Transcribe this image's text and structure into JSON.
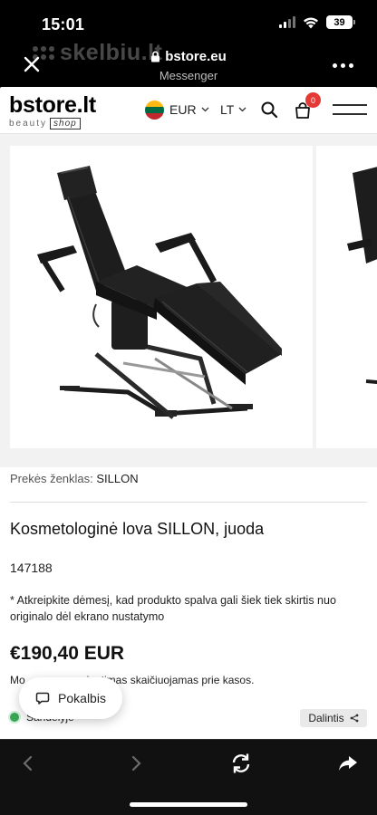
{
  "status_bar": {
    "time": "15:01",
    "battery": "39"
  },
  "browser": {
    "url": "bstore.eu",
    "subtitle": "Messenger",
    "watermark": "skelbiu.lt"
  },
  "site": {
    "logo_main": "bstore.lt",
    "logo_sub_a": "beauty",
    "logo_sub_b": "shop",
    "currency": "EUR",
    "language": "LT",
    "cart_count": "0"
  },
  "product": {
    "brand_label": "Prekės ženklas:",
    "brand_value": "SILLON",
    "title": "Kosmetologinė lova SILLON, juoda",
    "sku": "147188",
    "note": "* Atkreipkite dėmesį, kad produkto spalva gali šiek tiek skirtis nuo originalo dėl ekrano nustatymo",
    "price": "€190,40 EUR",
    "shipping_prefix": "Mo",
    "shipping_suffix": "siuntimas skaičiuojamas prie kasos.",
    "stock": "Sandėlyje",
    "share_label": "Dalintis"
  },
  "chat": {
    "label": "Pokalbis"
  },
  "colors": {
    "accent_red": "#e53935",
    "stock_green": "#3aa655",
    "chair": "#1c1c1c"
  }
}
